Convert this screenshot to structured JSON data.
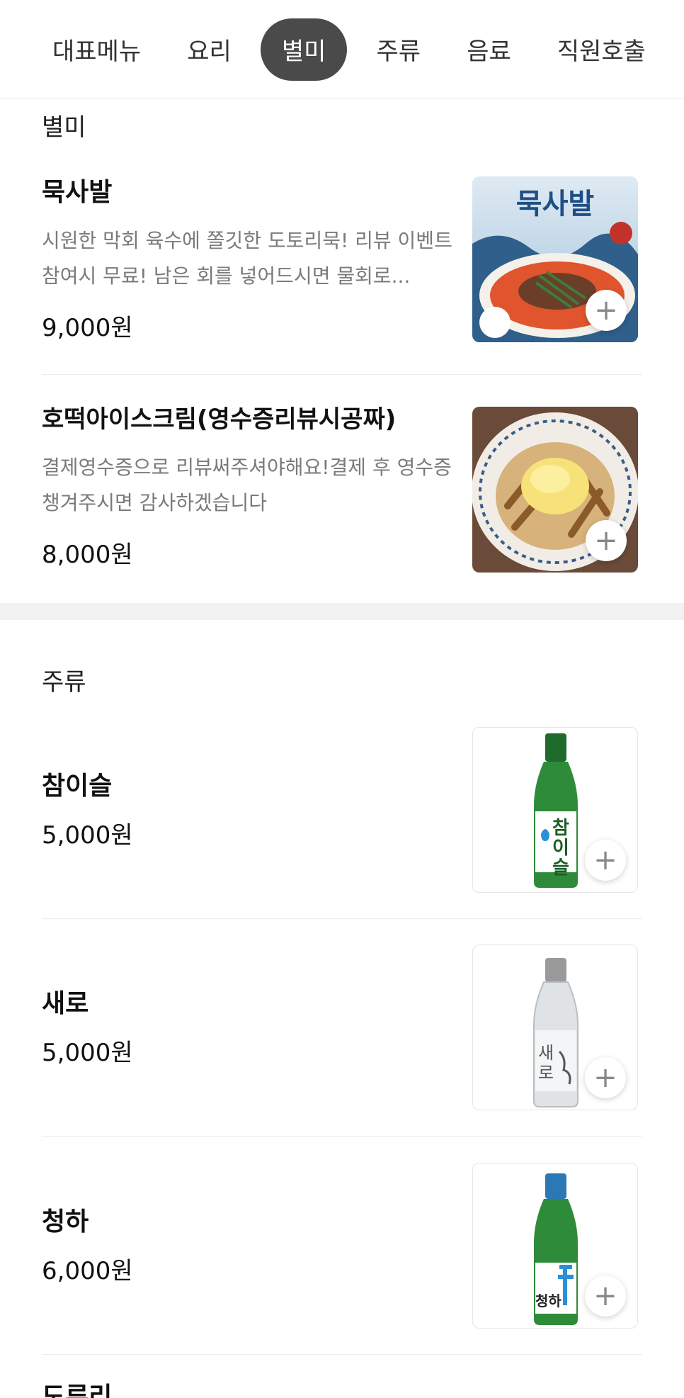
{
  "tabs": [
    "대표메뉴",
    "요리",
    "별미",
    "주류",
    "음료",
    "직원호출"
  ],
  "active_tab": "별미",
  "sections": {
    "byeolmi": {
      "title": "별미",
      "items": [
        {
          "name": "묵사발",
          "desc": "시원한 막회 육수에 쫄깃한 도토리묵! 리뷰 이벤트 참여시 무료! 남은 회를 넣어드시면 물회로...",
          "price": "9,000원",
          "image_text": "묵사발"
        },
        {
          "name": "호떡아이스크림(영수증리뷰시공짜)",
          "desc": "결제영수증으로 리뷰써주셔야해요!결제 후 영수증 챙겨주시면 감사하겠습니다",
          "price": "8,000원"
        }
      ]
    },
    "juryu": {
      "title": "주류",
      "items": [
        {
          "name": "참이슬",
          "price": "5,000원",
          "label": "참이슬"
        },
        {
          "name": "새로",
          "price": "5,000원",
          "label": "새로"
        },
        {
          "name": "청하",
          "price": "6,000원",
          "label": "청하"
        }
      ],
      "next_partial": "도루리"
    }
  },
  "plus_symbol": "+",
  "colors": {
    "active_tab_bg": "#4a4a4a",
    "price_text": "#111111",
    "desc_text": "#7a7a7a",
    "section_gap": "#f2f2f2",
    "bottle_green": "#2e8b3a"
  }
}
